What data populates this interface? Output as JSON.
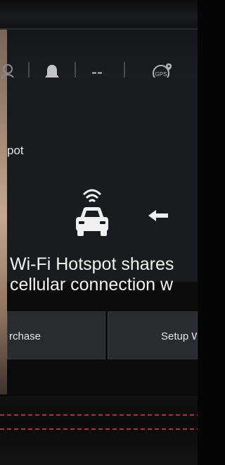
{
  "status_bar": {
    "connection_label": "--",
    "icons": [
      "user-icon",
      "bell-icon",
      "gps-icon"
    ],
    "gps_label": "GPS"
  },
  "screen": {
    "title": "pot",
    "message_line1": "Wi-Fi Hotspot shares",
    "message_line2": "cellular connection w",
    "icons": [
      "wifi-car-icon",
      "back-arrow-icon"
    ]
  },
  "buttons": {
    "purchase_label": "rchase",
    "setup_label": "Setup W"
  },
  "colors": {
    "screen_background": "#1a1b1e",
    "button_background": "#2a2b2e",
    "text": "#f2f2f2",
    "stitching": "#c43a44"
  }
}
